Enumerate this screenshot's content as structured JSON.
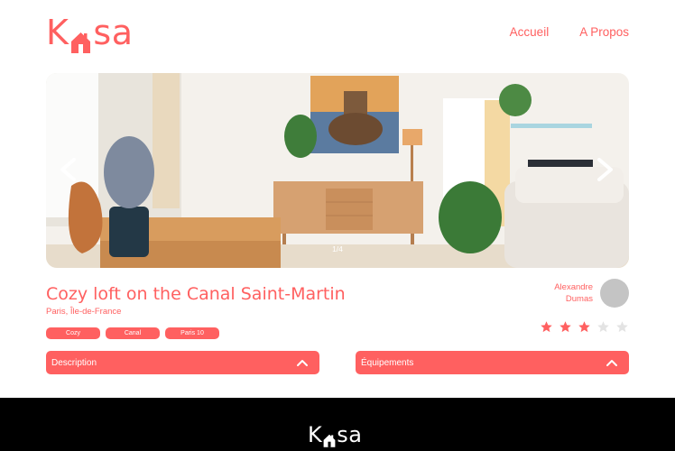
{
  "header": {
    "logo": {
      "left": "K",
      "right": "sa"
    },
    "nav": [
      {
        "label": "Accueil"
      },
      {
        "label": "A Propos"
      }
    ]
  },
  "gallery": {
    "counter": "1/4"
  },
  "listing": {
    "title": "Cozy loft on the Canal Saint-Martin",
    "location": "Paris, Île-de-France",
    "tags": [
      "Cozy",
      "Canal",
      "Paris 10"
    ],
    "host": {
      "first_name": "Alexandre",
      "last_name": "Dumas"
    },
    "rating": 3,
    "rating_max": 5
  },
  "collapses": [
    {
      "label": "Description"
    },
    {
      "label": "Équipements"
    }
  ],
  "footer": {
    "logo": {
      "left": "K",
      "right": "sa"
    }
  },
  "colors": {
    "primary": "#FF6060",
    "star_off": "#E3E3E3",
    "avatar": "#C4C4C4",
    "footer_bg": "#000000"
  }
}
